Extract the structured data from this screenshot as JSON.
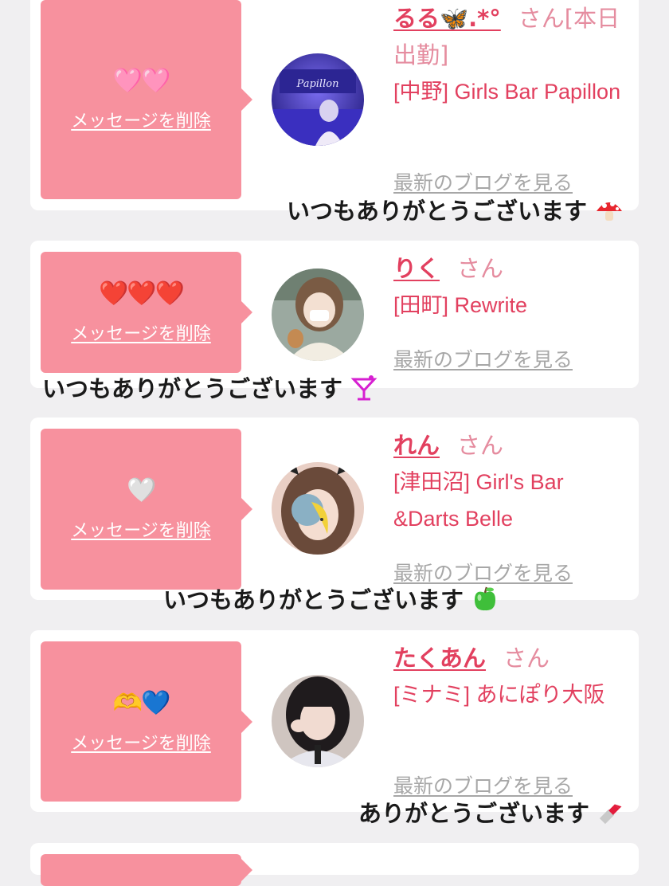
{
  "entries": [
    {
      "emoji": "🩷🩷",
      "delete_label": "メッセージを削除",
      "name": "るる🦋.*°",
      "name_suffix": "さん[本日出勤]",
      "shop": "[中野] Girls Bar Papillon",
      "blog_label": "最新のブログを見る",
      "thanks": "いつもありがとうございます",
      "thanks_icon": "mushroom-icon"
    },
    {
      "emoji": "❤️❤️❤️",
      "delete_label": "メッセージを削除",
      "name": "りく",
      "name_suffix": "さん",
      "shop": "[田町] Rewrite",
      "blog_label": "最新のブログを見る",
      "thanks": "いつもありがとうございます",
      "thanks_icon": "cocktail-icon"
    },
    {
      "emoji": "🤍",
      "delete_label": "メッセージを削除",
      "name": "れん",
      "name_suffix": "さん",
      "shop": "[津田沼] Girl's Bar &Darts Belle",
      "blog_label": "最新のブログを見る",
      "thanks": "いつもありがとうございます",
      "thanks_icon": "green-apple-icon"
    },
    {
      "emoji": "🫶💙",
      "delete_label": "メッセージを削除",
      "name": "たくあん",
      "name_suffix": "さん",
      "shop": "[ミナミ] あにぽり大阪",
      "blog_label": "最新のブログを見る",
      "thanks": "ありがとうございます",
      "thanks_icon": "lipstick-icon"
    }
  ]
}
